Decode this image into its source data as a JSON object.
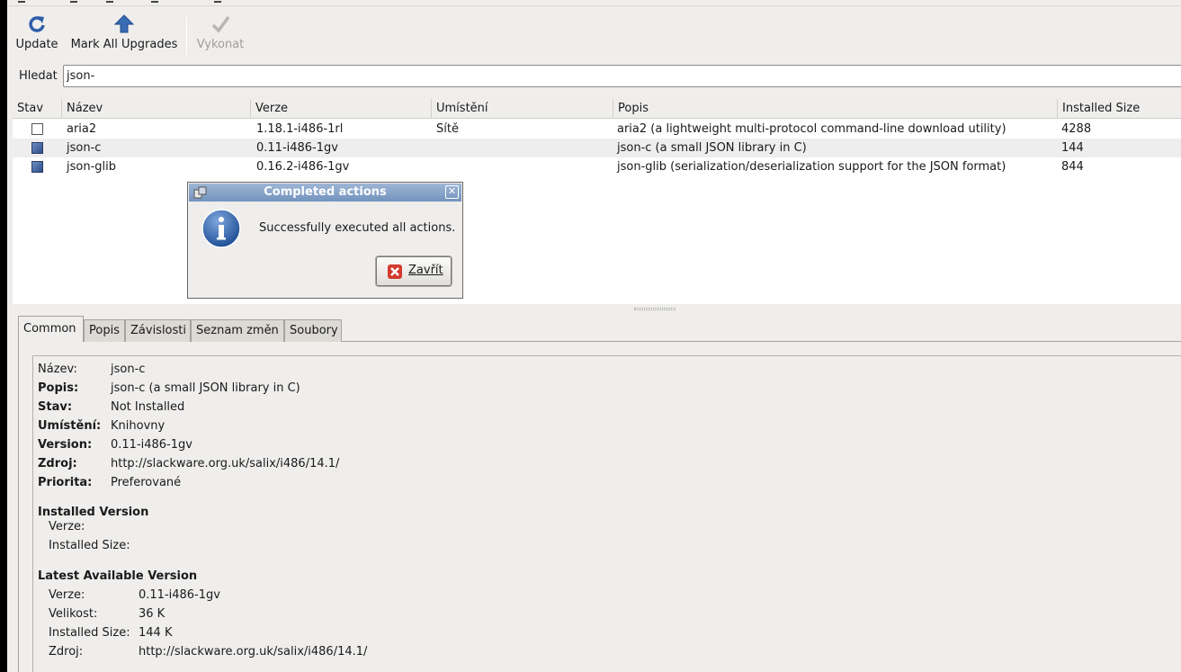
{
  "toolbar": {
    "update_label": "Update",
    "mark_all_label": "Mark All Upgrades",
    "execute_label": "Vykonat"
  },
  "search": {
    "label": "Hledat",
    "value": "json-"
  },
  "table": {
    "headers": [
      "Stav",
      "Název",
      "Verze",
      "Umístění",
      "Popis",
      "Installed Size"
    ],
    "rows": [
      {
        "state": "not-installed",
        "name": "aria2",
        "version": "1.18.1-i486-1rl",
        "location": "Sítě",
        "description": "aria2 (a lightweight multi-protocol command-line download utility)",
        "size": "4288"
      },
      {
        "state": "marked",
        "name": "json-c",
        "version": "0.11-i486-1gv",
        "location": "",
        "description": "json-c (a small JSON library in C)",
        "size": "144"
      },
      {
        "state": "marked",
        "name": "json-glib",
        "version": "0.16.2-i486-1gv",
        "location": "",
        "description": "json-glib (serialization/deserialization support for the JSON format)",
        "size": "844"
      }
    ]
  },
  "dialog": {
    "title": "Completed actions",
    "message": "Successfully executed all actions.",
    "close_label": "Zavřít"
  },
  "tabs": [
    "Common",
    "Popis",
    "Závislosti",
    "Seznam změn",
    "Soubory"
  ],
  "details": {
    "fields": [
      {
        "label": "Název:",
        "value": "json-c"
      },
      {
        "label": "Popis:",
        "value": "json-c (a small JSON library in C)"
      },
      {
        "label": "Stav:",
        "value": "Not Installed"
      },
      {
        "label": "Umístění:",
        "value": "Knihovny"
      },
      {
        "label": "Version:",
        "value": "0.11-i486-1gv"
      },
      {
        "label": "Zdroj:",
        "value": "http://slackware.org.uk/salix/i486/14.1/"
      },
      {
        "label": "Priorita:",
        "value": "Preferované"
      }
    ],
    "installed_heading": "Installed Version",
    "installed": [
      {
        "label": "Verze:",
        "value": ""
      },
      {
        "label": "Installed Size:",
        "value": ""
      }
    ],
    "latest_heading": "Latest Available Version",
    "latest": [
      {
        "label": "Verze:",
        "value": "0.11-i486-1gv"
      },
      {
        "label": "Velikost:",
        "value": "36 K"
      },
      {
        "label": "Installed Size:",
        "value": "144 K"
      },
      {
        "label": "Zdroj:",
        "value": "http://slackware.org.uk/salix/i486/14.1/"
      }
    ]
  }
}
